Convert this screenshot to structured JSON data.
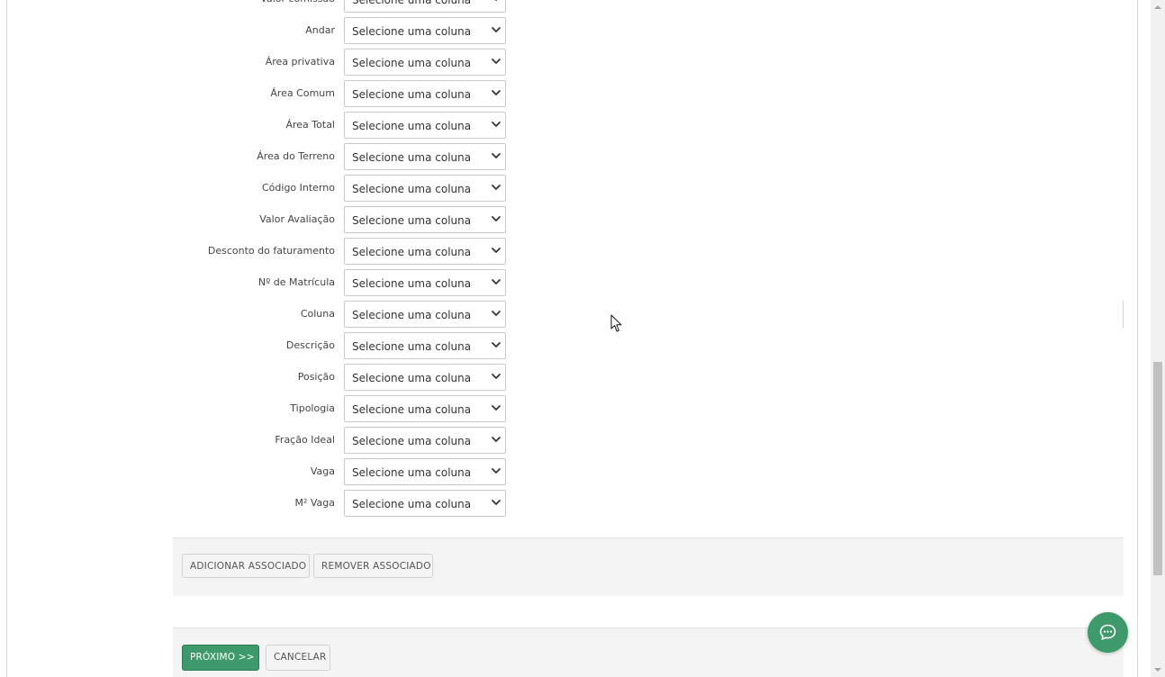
{
  "form": {
    "placeholder": "Selecione uma coluna",
    "fields": [
      {
        "label": "Valor comissão"
      },
      {
        "label": "Andar"
      },
      {
        "label": "Área privativa"
      },
      {
        "label": "Área Comum"
      },
      {
        "label": "Área Total"
      },
      {
        "label": "Área do Terreno"
      },
      {
        "label": "Código Interno"
      },
      {
        "label": "Valor Avaliação"
      },
      {
        "label": "Desconto do faturamento"
      },
      {
        "label": "Nº de Matrícula"
      },
      {
        "label": "Coluna"
      },
      {
        "label": "Descrição"
      },
      {
        "label": "Posição"
      },
      {
        "label": "Tipologia"
      },
      {
        "label": "Fração Ideal"
      },
      {
        "label": "Vaga"
      },
      {
        "label": "M² Vaga"
      }
    ]
  },
  "associates": {
    "add_label": "ADICIONAR ASSOCIADO",
    "remove_label": "REMOVER ASSOCIADO"
  },
  "footer": {
    "next_label": "PRÓXIMO >>",
    "cancel_label": "CANCELAR"
  },
  "colors": {
    "accent": "#3f9a6b",
    "panel_bg": "#f4f4f4"
  },
  "icons": {
    "select_arrow": "chevron-down-icon",
    "chat": "chat-bubble-icon",
    "cursor": "mouse-pointer-icon"
  }
}
